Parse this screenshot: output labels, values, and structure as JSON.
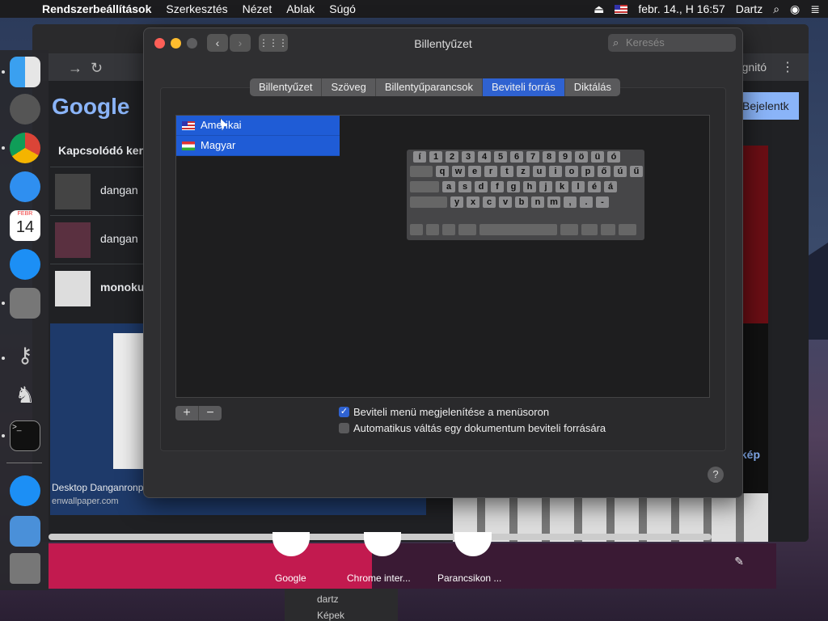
{
  "menubar": {
    "app_name": "Rendszerbeállítások",
    "items": [
      "Szerkesztés",
      "Nézet",
      "Ablak",
      "Súgó"
    ],
    "datetime": "febr. 14., H 16:57",
    "user": "Dartz"
  },
  "window": {
    "title": "Billentyűzet",
    "search_placeholder": "Keresés",
    "tabs": [
      "Billentyűzet",
      "Szöveg",
      "Billentyűparancsok",
      "Beviteli forrás",
      "Diktálás"
    ],
    "active_tab": "Beviteli forrás",
    "input_sources": [
      {
        "label": "Amerikai",
        "flag": "us"
      },
      {
        "label": "Magyar",
        "flag": "hu"
      }
    ],
    "add_label": "+",
    "remove_label": "−",
    "options": [
      {
        "label": "Beviteli menü megjelenítése a menüsoron",
        "checked": true
      },
      {
        "label": "Automatikus váltás egy dokumentum beviteli forrására",
        "checked": false
      }
    ],
    "help_label": "?"
  },
  "keyboard_rows": [
    [
      "í",
      "1",
      "2",
      "3",
      "4",
      "5",
      "6",
      "7",
      "8",
      "9",
      "ö",
      "ü",
      "ó"
    ],
    [
      "q",
      "w",
      "e",
      "r",
      "t",
      "z",
      "u",
      "i",
      "o",
      "p",
      "ő",
      "ú",
      "ű"
    ],
    [
      "a",
      "s",
      "d",
      "f",
      "g",
      "h",
      "j",
      "k",
      "l",
      "é",
      "á"
    ],
    [
      "y",
      "x",
      "c",
      "v",
      "b",
      "n",
      "m",
      ",",
      ".",
      "-"
    ]
  ],
  "browser": {
    "incognito_label": "gnitó",
    "google_logo": "Google",
    "signin_label": "Bejelentk",
    "related_heading": "Kapcsolódó ker",
    "results": [
      "dangan",
      "dangan",
      "monoku"
    ],
    "card_caption": "Desktop Danganronp",
    "card_url": "enwallpaper.com",
    "image_link": "kép",
    "shortcuts": [
      "Google",
      "Chrome inter...",
      "Parancsikon ..."
    ]
  },
  "finder": {
    "items": [
      "dartz",
      "Képek"
    ]
  },
  "dock_icons": [
    "finder-icon",
    "launchpad-icon",
    "chrome-icon",
    "safari-icon",
    "calendar-icon",
    "app-store-icon",
    "system-preferences-icon",
    "keychain-icon",
    "chess-icon",
    "terminal-icon",
    "downloads-icon",
    "folder-icon",
    "trash-icon"
  ],
  "calendar": {
    "month": "FEBR",
    "day": "14"
  }
}
